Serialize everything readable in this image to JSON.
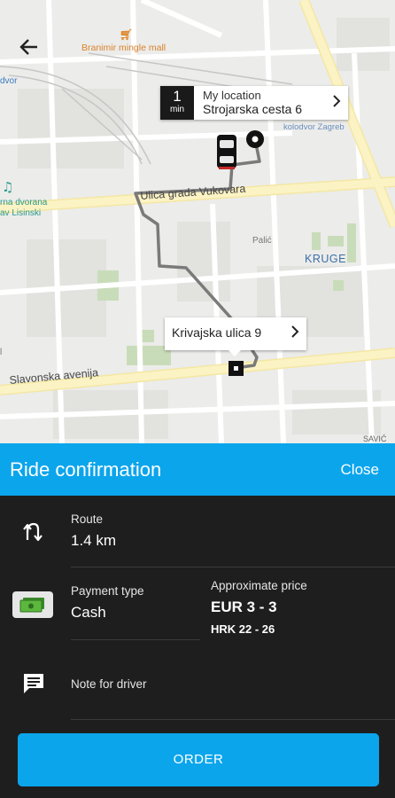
{
  "map": {
    "labels": {
      "mall": "Branimir mingle mall",
      "street_vukovara": "Ulica grada Vukovara",
      "street_slavonska": "Slavonska avenija",
      "district_kruge": "KRUGE",
      "dvor": "dvor",
      "dvorana_line1": "rna dvorana",
      "dvorana_line2": "av Lisinski",
      "palic": "Palić",
      "kolodvor": "kolodvor Zagreb",
      "partial_l": "l",
      "savic": "SAVIĆ"
    },
    "pickup": {
      "eta_value": "1",
      "eta_unit": "min",
      "title": "My location",
      "address": "Strojarska cesta 6"
    },
    "destination": {
      "address": "Krivajska ulica 9"
    },
    "colors": {
      "route_line": "#7a7a7a",
      "road_major": "#fbf3c4",
      "park": "#c9dcb9"
    }
  },
  "panel": {
    "title": "Ride confirmation",
    "close_label": "Close",
    "route": {
      "label": "Route",
      "value": "1.4 km"
    },
    "payment": {
      "label": "Payment type",
      "value": "Cash"
    },
    "price": {
      "label": "Approximate price",
      "eur": "EUR 3 - 3",
      "hrk": "HRK 22 - 26"
    },
    "note": {
      "label": "Note for driver"
    },
    "order_label": "ORDER",
    "colors": {
      "accent": "#0ba5ec",
      "background": "#1e1e1e"
    }
  }
}
